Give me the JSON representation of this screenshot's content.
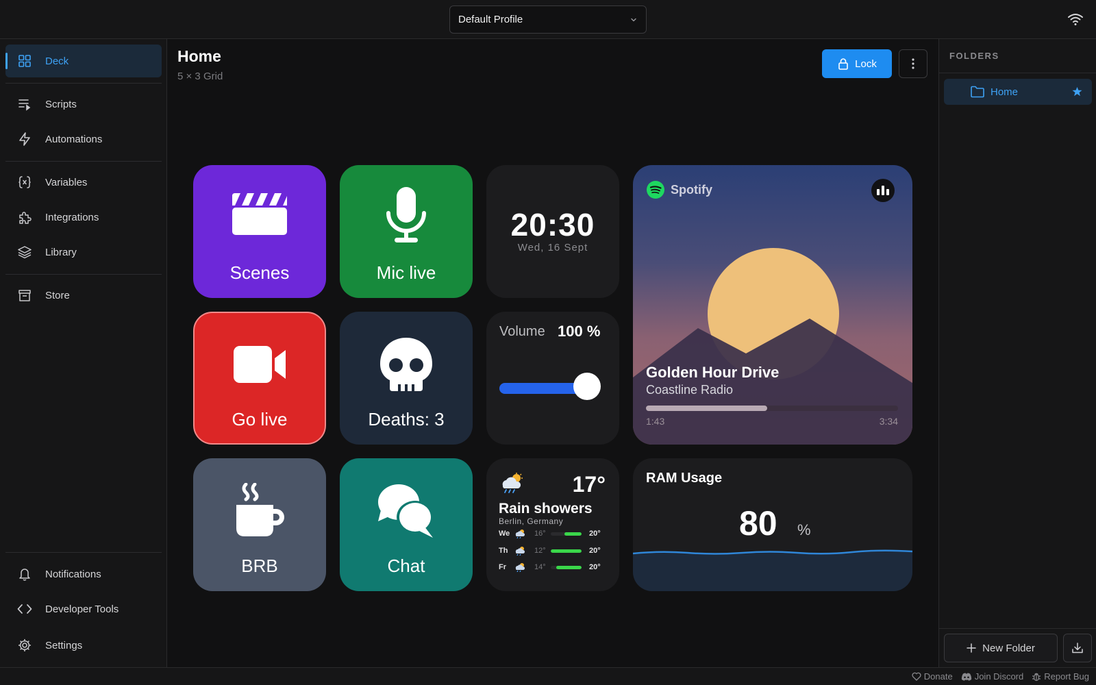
{
  "header": {
    "profile": "Default Profile"
  },
  "sidebar": {
    "items": [
      {
        "label": "Deck",
        "icon": "grid-icon"
      },
      {
        "label": "Scripts",
        "icon": "list-icon"
      },
      {
        "label": "Automations",
        "icon": "lightning-icon"
      },
      {
        "label": "Variables",
        "icon": "braces-icon"
      },
      {
        "label": "Integrations",
        "icon": "puzzle-icon"
      },
      {
        "label": "Library",
        "icon": "layers-icon"
      },
      {
        "label": "Store",
        "icon": "store-icon"
      },
      {
        "label": "Notifications",
        "icon": "bell-icon"
      },
      {
        "label": "Developer Tools",
        "icon": "code-icon"
      },
      {
        "label": "Settings",
        "icon": "gear-icon"
      }
    ],
    "active": "Deck"
  },
  "main": {
    "title": "Home",
    "subtitle": "5 × 3 Grid",
    "lock_label": "Lock"
  },
  "tiles": {
    "scenes": "Scenes",
    "mic": "Mic live",
    "golive": "Go live",
    "deaths": "Deaths: 3",
    "brb": "BRB",
    "chat": "Chat"
  },
  "clock": {
    "time": "20:30",
    "date": "Wed, 16 Sept"
  },
  "volume": {
    "label": "Volume",
    "value": "100 %",
    "level": 1.0
  },
  "spotify": {
    "brand": "Spotify",
    "title": "Golden Hour Drive",
    "artist": "Coastline Radio",
    "elapsed": "1:43",
    "total": "3:34",
    "progress": 0.48
  },
  "weather": {
    "temp": "17°",
    "condition": "Rain showers",
    "location": "Berlin, Germany",
    "forecast": [
      {
        "day": "We",
        "low": "16°",
        "high": "20°",
        "bar_start": 0.45,
        "bar_end": 1.0
      },
      {
        "day": "Th",
        "low": "12°",
        "high": "20°",
        "bar_start": 0.0,
        "bar_end": 1.0
      },
      {
        "day": "Fr",
        "low": "14°",
        "high": "20°",
        "bar_start": 0.18,
        "bar_end": 1.0
      }
    ]
  },
  "ram": {
    "title": "RAM Usage",
    "value": "80",
    "unit": "%"
  },
  "folders": {
    "heading": "FOLDERS",
    "items": [
      {
        "label": "Home",
        "favorite": true
      }
    ],
    "new_label": "New Folder"
  },
  "footer": {
    "donate": "Donate",
    "discord": "Join Discord",
    "bug": "Report Bug"
  },
  "colors": {
    "accent": "#1e8cf0",
    "scenes": "#6d28d9",
    "mic": "#178a3c",
    "golive": "#dc2626",
    "chat": "#107a70",
    "spotify": "#1ed760"
  }
}
